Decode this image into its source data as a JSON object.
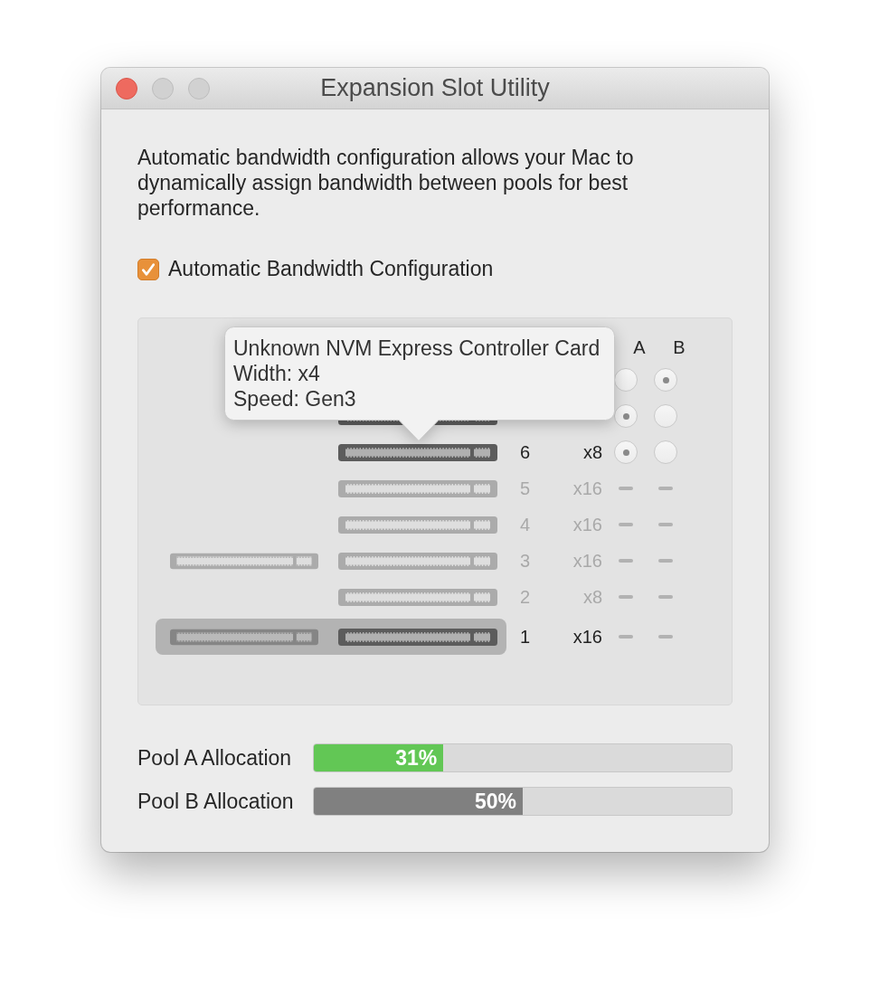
{
  "window": {
    "title": "Expansion Slot Utility",
    "controls": [
      {
        "kind": "close",
        "disabled": false
      },
      {
        "kind": "minimize",
        "disabled": true
      },
      {
        "kind": "zoom",
        "disabled": true
      }
    ]
  },
  "description": "Automatic bandwidth configuration allows your Mac to dynamically assign bandwidth between pools for best performance.",
  "auto_config": {
    "label": "Automatic Bandwidth Configuration",
    "checked": true
  },
  "slots": {
    "columns": [
      "A",
      "B"
    ],
    "tooltip": {
      "lines": [
        "Unknown NVM Express Controller Card",
        "Width: x4",
        "Speed: Gen3"
      ]
    },
    "rows": [
      {
        "kind": "assignable",
        "selected": false,
        "mpx_connector": false,
        "pools": [
          {
            "selected": false
          },
          {
            "selected": true
          }
        ]
      },
      {
        "kind": "assignable",
        "selected": false,
        "mpx_connector": false,
        "occupied": true,
        "pools": [
          {
            "selected": true
          },
          {
            "selected": false
          }
        ]
      },
      {
        "slot": "6",
        "lanes": "x8",
        "kind": "assignable",
        "selected": false,
        "mpx_connector": false,
        "occupied": true,
        "pools": [
          {
            "selected": true
          },
          {
            "selected": false
          }
        ]
      },
      {
        "slot": "5",
        "lanes": "x16",
        "kind": "fixed",
        "selected": false,
        "mpx_connector": false,
        "occupied": false
      },
      {
        "slot": "4",
        "lanes": "x16",
        "kind": "fixed",
        "selected": false,
        "mpx_connector": false,
        "occupied": false
      },
      {
        "slot": "3",
        "lanes": "x16",
        "kind": "fixed",
        "selected": false,
        "mpx_connector": true,
        "occupied": false
      },
      {
        "slot": "2",
        "lanes": "x8",
        "kind": "fixed",
        "selected": false,
        "mpx_connector": false,
        "occupied": false
      },
      {
        "slot": "1",
        "lanes": "x16",
        "kind": "fixed",
        "selected": true,
        "mpx_connector": true,
        "occupied": true
      }
    ]
  },
  "pools": [
    {
      "label": "Pool A Allocation",
      "level": 0.31,
      "reading": "31%",
      "color": "#62c755"
    },
    {
      "label": "Pool B Allocation",
      "level": 0.5,
      "reading": "50%",
      "color": "#808080"
    }
  ]
}
